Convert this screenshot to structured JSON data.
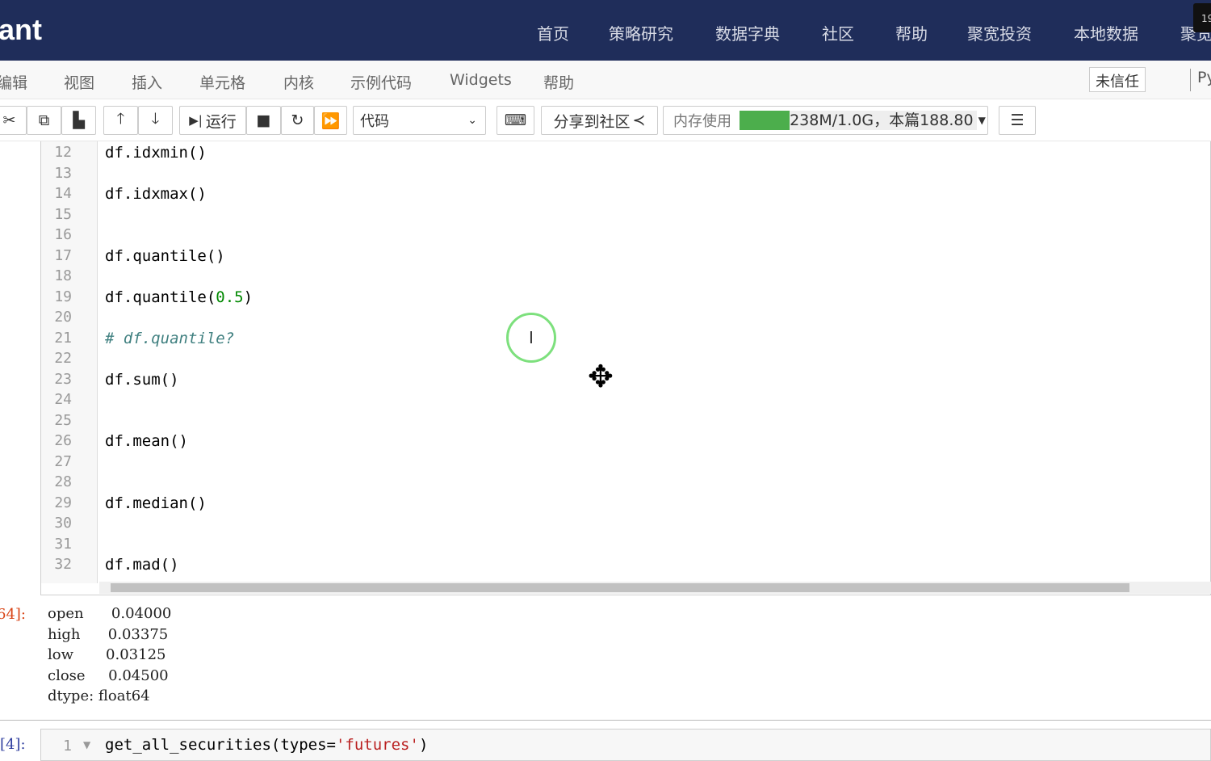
{
  "header": {
    "logo": "ant",
    "nav": [
      "首页",
      "策略研究",
      "数据字典",
      "社区",
      "帮助",
      "聚宽投资",
      "本地数据",
      "聚宽"
    ],
    "badge": "19"
  },
  "menu": {
    "items": [
      "编辑",
      "视图",
      "插入",
      "单元格",
      "内核",
      "示例代码",
      "Widgets",
      "帮助"
    ],
    "trust": "未信任",
    "kernel": "Py"
  },
  "toolbar": {
    "run": "运行",
    "cell_type": "代码",
    "share": "分享到社区",
    "mem_label": "内存使用",
    "mem_text": "238M/1.0G，本篇188.80",
    "mem_fraction": 0.23
  },
  "code": {
    "lines": [
      {
        "n": "12",
        "text": "df.idxmin()"
      },
      {
        "n": "13",
        "text": ""
      },
      {
        "n": "14",
        "text": "df.idxmax()"
      },
      {
        "n": "15",
        "text": ""
      },
      {
        "n": "16",
        "text": ""
      },
      {
        "n": "17",
        "text": "df.quantile()"
      },
      {
        "n": "18",
        "text": ""
      },
      {
        "n": "19",
        "pre": "df.quantile(",
        "num": "0.5",
        "post": ")"
      },
      {
        "n": "20",
        "text": ""
      },
      {
        "n": "21",
        "comment": "# df.quantile?"
      },
      {
        "n": "22",
        "text": ""
      },
      {
        "n": "23",
        "text": "df.sum()"
      },
      {
        "n": "24",
        "text": ""
      },
      {
        "n": "25",
        "text": ""
      },
      {
        "n": "26",
        "text": "df.mean()"
      },
      {
        "n": "27",
        "text": ""
      },
      {
        "n": "28",
        "text": ""
      },
      {
        "n": "29",
        "text": "df.median()"
      },
      {
        "n": "30",
        "text": ""
      },
      {
        "n": "31",
        "text": ""
      },
      {
        "n": "32",
        "text": "df.mad()"
      }
    ]
  },
  "output": {
    "prompt": "64]:",
    "rows": [
      "open      0.04000",
      "high      0.03375",
      "low       0.03125",
      "close     0.04500",
      "dtype: float64"
    ]
  },
  "next_cell": {
    "prompt": "[4]:",
    "line": "1",
    "pre": "get_all_securities(types=",
    "str": "'futures'",
    "post": ")"
  }
}
